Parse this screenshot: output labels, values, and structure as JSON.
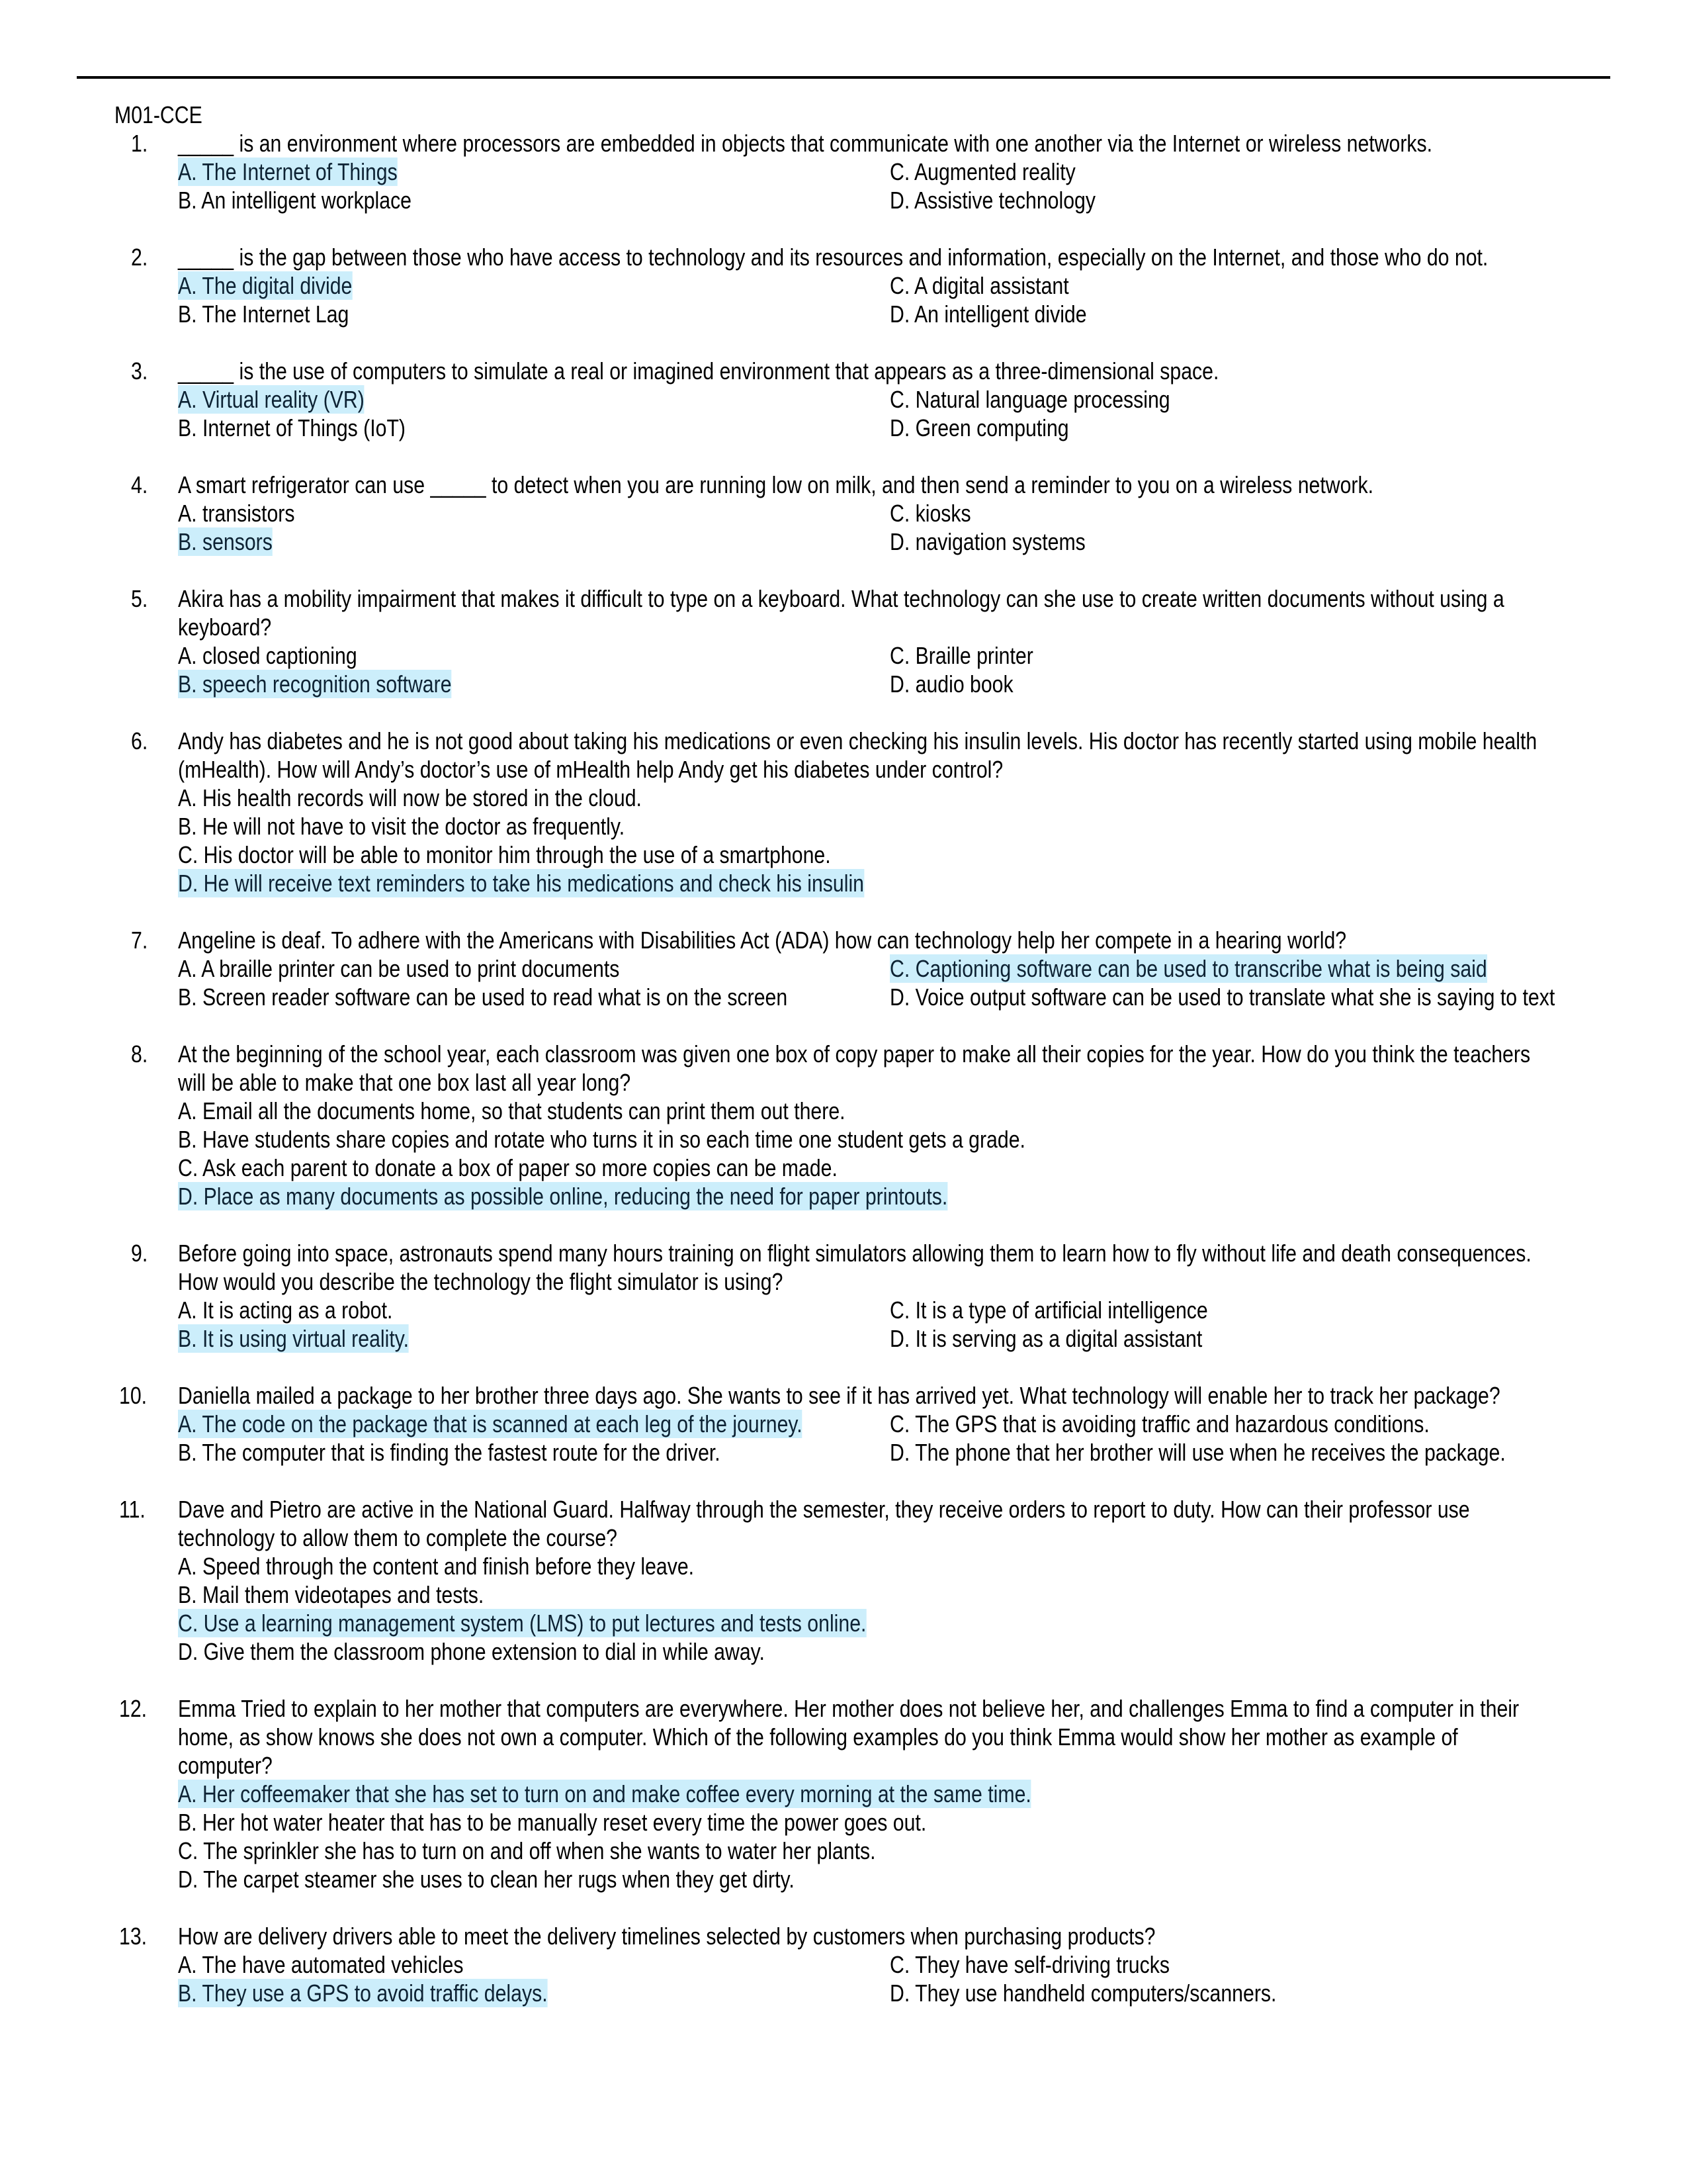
{
  "document": {
    "title": "M01-CCE",
    "highlight_color": "#CCEEFB",
    "highlight_text_color": "#0D2233"
  },
  "questions": [
    {
      "number": "1.",
      "layout": "two-column",
      "stem_lines": [
        "_____ is an environment where processors are embedded in objects that communicate with one another via the Internet or wireless networks."
      ],
      "options": [
        {
          "label": "A. The Internet of Things",
          "correct": true
        },
        {
          "label": "B. An intelligent workplace",
          "correct": false
        },
        {
          "label": "C. Augmented reality",
          "correct": false
        },
        {
          "label": "D. Assistive technology",
          "correct": false
        }
      ]
    },
    {
      "number": "2.",
      "layout": "two-column",
      "stem_lines": [
        "_____ is the gap between those who have access to technology and its resources and information, especially on the Internet, and those who do not."
      ],
      "options": [
        {
          "label": "A. The digital divide",
          "correct": true
        },
        {
          "label": "B. The Internet Lag",
          "correct": false
        },
        {
          "label": "C. A digital assistant",
          "correct": false
        },
        {
          "label": "D. An intelligent divide",
          "correct": false
        }
      ]
    },
    {
      "number": "3.",
      "layout": "two-column",
      "stem_lines": [
        "_____ is the use of computers to simulate a real or imagined environment that appears as a three-dimensional space."
      ],
      "options": [
        {
          "label": "A. Virtual reality (VR)",
          "correct": true
        },
        {
          "label": "B. Internet of Things (IoT)",
          "correct": false
        },
        {
          "label": "C. Natural language processing",
          "correct": false
        },
        {
          "label": "D. Green computing",
          "correct": false
        }
      ]
    },
    {
      "number": "4.",
      "layout": "two-column",
      "stem_lines": [
        "A smart refrigerator can use _____ to detect when you are running low on milk, and then send a reminder to you on a wireless network."
      ],
      "options": [
        {
          "label": "A. transistors",
          "correct": false
        },
        {
          "label": "B. sensors",
          "correct": true
        },
        {
          "label": "C. kiosks",
          "correct": false
        },
        {
          "label": "D. navigation systems",
          "correct": false
        }
      ]
    },
    {
      "number": "5.",
      "layout": "two-column",
      "stem_lines": [
        "Akira has a mobility impairment that makes it difficult to type on a keyboard. What technology can she use to create written documents without using a",
        "keyboard?"
      ],
      "options": [
        {
          "label": "A. closed captioning",
          "correct": false
        },
        {
          "label": "B. speech recognition software",
          "correct": true
        },
        {
          "label": "C. Braille printer",
          "correct": false
        },
        {
          "label": "D. audio book",
          "correct": false
        }
      ]
    },
    {
      "number": "6.",
      "layout": "stacked",
      "stem_lines": [
        "Andy has diabetes and he is not good about taking his medications or even checking his insulin levels. His doctor has recently started using mobile health",
        "(mHealth). How will Andy’s doctor’s use of mHealth help Andy get his diabetes under control?"
      ],
      "options": [
        {
          "label": "A. His health records will now be stored in the cloud.",
          "correct": false
        },
        {
          "label": "B. He will not have to visit the doctor as frequently.",
          "correct": false
        },
        {
          "label": "C. His doctor will be able to monitor him through the use of a smartphone.",
          "correct": false
        },
        {
          "label": "D. He will receive text reminders to take his medications and check his insulin",
          "correct": true
        }
      ]
    },
    {
      "number": "7.",
      "layout": "two-column",
      "stem_lines": [
        "Angeline is deaf. To adhere with the Americans with Disabilities Act (ADA) how can technology help her compete in a hearing world?"
      ],
      "options": [
        {
          "label": "A. A braille printer can be used to print documents",
          "correct": false
        },
        {
          "label": "B. Screen reader software can be used to read what is on the screen",
          "correct": false
        },
        {
          "label": "C. Captioning software can be used to transcribe what is being said",
          "correct": true
        },
        {
          "label": "D. Voice output software can be used to translate what she is saying to text",
          "correct": false
        }
      ]
    },
    {
      "number": "8.",
      "layout": "stacked",
      "stem_lines": [
        "At the beginning of the school year, each classroom was given one box of copy paper to make all their copies for the year. How do you think the teachers",
        "will be able to make that one box last all year long?"
      ],
      "options": [
        {
          "label": "A. Email all the documents home, so that students can print them out there.",
          "correct": false
        },
        {
          "label": "B. Have students share copies and rotate who turns it in so each time one student gets a grade.",
          "correct": false
        },
        {
          "label": "C. Ask each parent to donate a box of paper so more copies can be made.",
          "correct": false
        },
        {
          "label": "D. Place as many documents as possible online, reducing the need for paper printouts.",
          "correct": true
        }
      ]
    },
    {
      "number": "9.",
      "layout": "two-column",
      "stem_lines": [
        "Before going into space, astronauts spend many hours training on flight simulators allowing them to learn how to fly without life and death consequences.",
        "How would you describe the technology the flight simulator is using?"
      ],
      "options": [
        {
          "label": "A. It is acting as a robot.",
          "correct": false
        },
        {
          "label": "B. It is using virtual reality.",
          "correct": true
        },
        {
          "label": "C. It is a type of artificial intelligence",
          "correct": false
        },
        {
          "label": "D. It is serving as a digital assistant",
          "correct": false
        }
      ]
    },
    {
      "number": "10.",
      "layout": "two-column",
      "stem_lines": [
        "Daniella mailed a package to her brother three days ago. She wants to see if it has arrived yet. What technology will enable her to track her package?"
      ],
      "options": [
        {
          "label": "A. The code on the package that is scanned at each leg of the journey.",
          "correct": true
        },
        {
          "label": "B. The computer that is finding the fastest route for the driver.",
          "correct": false
        },
        {
          "label": "C. The GPS that is avoiding traffic and hazardous conditions.",
          "correct": false
        },
        {
          "label": "D. The phone that her brother will use when he receives the package.",
          "correct": false
        }
      ]
    },
    {
      "number": "11.",
      "layout": "stacked",
      "stem_lines": [
        "Dave and Pietro are active in the National Guard. Halfway through the semester, they receive orders to report to duty. How can their professor use",
        "technology to allow them to complete the course?"
      ],
      "options": [
        {
          "label": "A. Speed through the content and finish before they leave.",
          "correct": false
        },
        {
          "label": "B. Mail them videotapes and tests.",
          "correct": false
        },
        {
          "label": "C. Use a learning management system (LMS) to put lectures and tests online.",
          "correct": true
        },
        {
          "label": "D. Give them the classroom phone extension to dial in while away.",
          "correct": false
        }
      ]
    },
    {
      "number": "12.",
      "layout": "stacked",
      "stem_lines": [
        "Emma Tried to explain to her mother that computers are everywhere. Her mother does not believe her, and challenges Emma to find a computer in their",
        "home, as show knows she does not own a computer. Which of the following examples do you think Emma would show her mother as example of",
        "computer?"
      ],
      "options": [
        {
          "label": "A. Her coffeemaker that she has set to turn on and make coffee every morning at the same time.",
          "correct": true
        },
        {
          "label": "B. Her hot water heater that has to be manually reset every time the power goes out.",
          "correct": false
        },
        {
          "label": "C. The sprinkler she has to turn on and off when she wants to water her plants.",
          "correct": false
        },
        {
          "label": "D. The carpet steamer she uses to clean her rugs when they get dirty.",
          "correct": false
        }
      ]
    },
    {
      "number": "13.",
      "layout": "two-column",
      "stem_lines": [
        "How are delivery drivers able to meet the delivery timelines selected by customers when purchasing products?"
      ],
      "options": [
        {
          "label": "A. The have automated vehicles",
          "correct": false
        },
        {
          "label": "B. They use a GPS to avoid traffic delays.",
          "correct": true
        },
        {
          "label": "C. They have self-driving trucks",
          "correct": false
        },
        {
          "label": "D. They use handheld computers/scanners.",
          "correct": false
        }
      ]
    }
  ]
}
